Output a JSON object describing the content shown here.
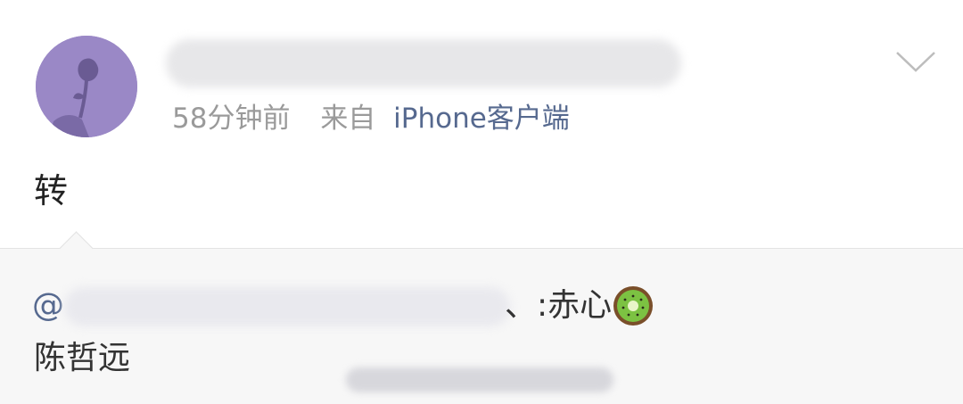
{
  "post": {
    "meta": {
      "time": "58分钟前",
      "from_label": "来自",
      "device": "iPhone客户端"
    },
    "text": "转"
  },
  "quote": {
    "mention_prefix": "@",
    "tail_text": "、:赤心",
    "line2": "陈哲远"
  },
  "icons": {
    "avatar": "avatar-rose-image",
    "menu": "chevron-down-icon",
    "emoji": "kiwi-emoji"
  },
  "colors": {
    "link": "#56698f",
    "meta_gray": "#9a9a9a",
    "avatar_bg": "#9a88c6",
    "quote_bg": "#f7f7f7"
  }
}
